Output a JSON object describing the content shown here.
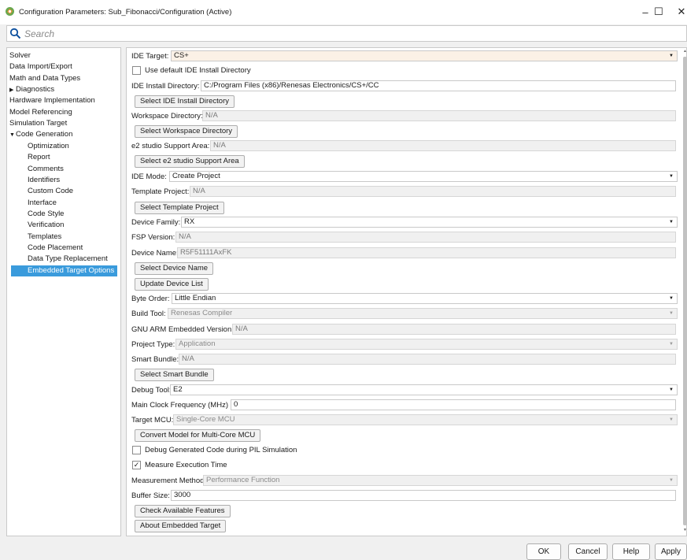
{
  "window": {
    "title": "Configuration Parameters: Sub_Fibonacci/Configuration (Active)",
    "minimize": "–",
    "maximize": "☐",
    "close": "✕"
  },
  "search": {
    "placeholder": "Search"
  },
  "tree": {
    "items": [
      {
        "label": "Solver",
        "level": 0,
        "arrow": ""
      },
      {
        "label": "Data Import/Export",
        "level": 0,
        "arrow": ""
      },
      {
        "label": "Math and Data Types",
        "level": 0,
        "arrow": ""
      },
      {
        "label": "Diagnostics",
        "level": 0,
        "arrow": "▶"
      },
      {
        "label": "Hardware Implementation",
        "level": 0,
        "arrow": ""
      },
      {
        "label": "Model Referencing",
        "level": 0,
        "arrow": ""
      },
      {
        "label": "Simulation Target",
        "level": 0,
        "arrow": ""
      },
      {
        "label": "Code Generation",
        "level": 0,
        "arrow": "▼"
      },
      {
        "label": "Optimization",
        "level": 1,
        "arrow": ""
      },
      {
        "label": "Report",
        "level": 1,
        "arrow": ""
      },
      {
        "label": "Comments",
        "level": 1,
        "arrow": ""
      },
      {
        "label": "Identifiers",
        "level": 1,
        "arrow": ""
      },
      {
        "label": "Custom Code",
        "level": 1,
        "arrow": ""
      },
      {
        "label": "Interface",
        "level": 1,
        "arrow": ""
      },
      {
        "label": "Code Style",
        "level": 1,
        "arrow": ""
      },
      {
        "label": "Verification",
        "level": 1,
        "arrow": ""
      },
      {
        "label": "Templates",
        "level": 1,
        "arrow": ""
      },
      {
        "label": "Code Placement",
        "level": 1,
        "arrow": ""
      },
      {
        "label": "Data Type Replacement",
        "level": 1,
        "arrow": ""
      },
      {
        "label": "Embedded Target Options",
        "level": 1,
        "arrow": "",
        "selected": true
      }
    ]
  },
  "panel": {
    "ide_target": {
      "label": "IDE Target:",
      "value": "CS+"
    },
    "use_default_ide": {
      "label": "Use default IDE Install Directory",
      "checked": false
    },
    "ide_install_dir": {
      "label": "IDE Install Directory:",
      "value": "C:/Program Files (x86)/Renesas Electronics/CS+/CC"
    },
    "select_ide_dir_btn": "Select IDE Install Directory",
    "workspace_dir": {
      "label": "Workspace Directory:",
      "value": "N/A"
    },
    "select_workspace_btn": "Select Workspace Directory",
    "e2_support_area": {
      "label": "e2 studio Support Area:",
      "value": "N/A"
    },
    "select_e2_btn": "Select e2 studio Support Area",
    "ide_mode": {
      "label": "IDE Mode:",
      "value": "Create Project"
    },
    "template_project": {
      "label": "Template Project:",
      "value": "N/A"
    },
    "select_template_btn": "Select Template Project",
    "device_family": {
      "label": "Device Family:",
      "value": "RX"
    },
    "fsp_version": {
      "label": "FSP Version:",
      "value": "N/A"
    },
    "device_name": {
      "label": "Device Name:",
      "value": "R5F51111AxFK"
    },
    "select_device_btn": "Select Device Name",
    "update_device_btn": "Update Device List",
    "byte_order": {
      "label": "Byte Order:",
      "value": "Little Endian"
    },
    "build_tool": {
      "label": "Build Tool:",
      "value": "Renesas Compiler"
    },
    "gnu_arm_version": {
      "label": "GNU ARM Embedded Version:",
      "value": "N/A"
    },
    "project_type": {
      "label": "Project Type:",
      "value": "Application"
    },
    "smart_bundle": {
      "label": "Smart Bundle:",
      "value": "N/A"
    },
    "select_smart_bundle_btn": "Select Smart Bundle",
    "debug_tool": {
      "label": "Debug Tool:",
      "value": "E2"
    },
    "main_clock": {
      "label": "Main Clock Frequency (MHz) :",
      "value": "0"
    },
    "target_mcu": {
      "label": "Target MCU:",
      "value": "Single-Core MCU"
    },
    "convert_multicore_btn": "Convert Model for Multi-Core MCU",
    "debug_pil": {
      "label": "Debug Generated Code during PIL Simulation",
      "checked": false
    },
    "measure_exec": {
      "label": "Measure Execution Time",
      "checked": true,
      "mark": "✓"
    },
    "measurement_method": {
      "label": "Measurement Method:",
      "value": "Performance Function"
    },
    "buffer_size": {
      "label": "Buffer Size:",
      "value": "3000"
    },
    "check_features_btn": "Check Available Features",
    "about_target_btn": "About Embedded Target",
    "dropdown_arrow": "▼"
  },
  "footer": {
    "ok": "OK",
    "cancel": "Cancel",
    "help": "Help",
    "apply": "Apply"
  },
  "colors": {
    "selection": "#3a9bdc",
    "ide_target_bg": "#fbf1e6"
  }
}
